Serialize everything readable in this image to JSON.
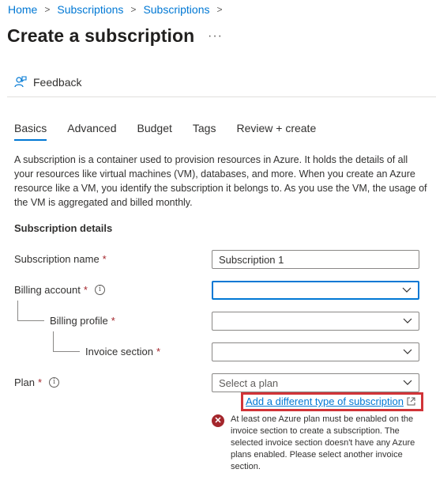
{
  "breadcrumb": {
    "items": [
      "Home",
      "Subscriptions",
      "Subscriptions"
    ],
    "separator": ">"
  },
  "page": {
    "title": "Create a subscription",
    "more": "···"
  },
  "toolbar": {
    "feedback_label": "Feedback",
    "feedback_icon": "feedback-icon"
  },
  "tabs": [
    {
      "label": "Basics",
      "active": true
    },
    {
      "label": "Advanced",
      "active": false
    },
    {
      "label": "Budget",
      "active": false
    },
    {
      "label": "Tags",
      "active": false
    },
    {
      "label": "Review + create",
      "active": false
    }
  ],
  "description": "A subscription is a container used to provision resources in Azure. It holds the details of all your resources like virtual machines (VM), databases, and more. When you create an Azure resource like a VM, you identify the subscription it belongs to. As you use the VM, the usage of the VM is aggregated and billed monthly.",
  "form": {
    "section_title": "Subscription details",
    "required_marker": "*",
    "info_glyph": "i",
    "subscription_name": {
      "label": "Subscription name",
      "value": "Subscription 1"
    },
    "billing_account": {
      "label": "Billing account",
      "value": ""
    },
    "billing_profile": {
      "label": "Billing profile",
      "value": ""
    },
    "invoice_section": {
      "label": "Invoice section",
      "value": ""
    },
    "plan": {
      "label": "Plan",
      "placeholder": "Select a plan"
    },
    "add_link": "Add a different type of subscription",
    "error": {
      "icon": "error-icon",
      "glyph": "✕",
      "message": "At least one Azure plan must be enabled on the invoice section to create a subscription. The selected invoice section doesn't have any Azure plans enabled. Please select another invoice section."
    }
  },
  "colors": {
    "accent": "#0078d4",
    "error": "#a4262c",
    "highlight": "#d13438"
  }
}
